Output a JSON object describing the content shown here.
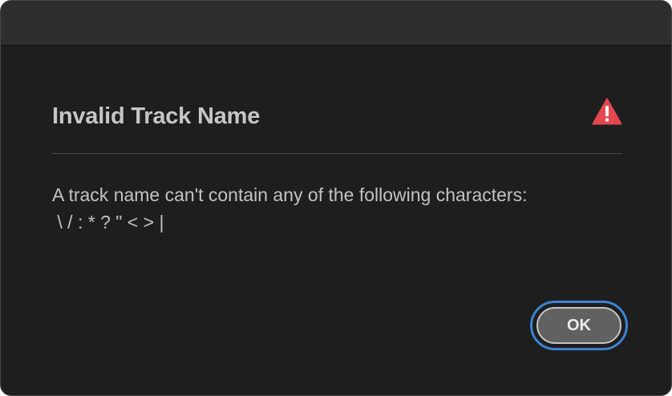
{
  "dialog": {
    "title": "Invalid Track Name",
    "icon": "warning-icon",
    "icon_color": "#e34850",
    "message_lines": [
      "A track name can't contain any of the following characters:",
      " \\ / : * ? \" < > |"
    ],
    "ok_label": "OK"
  },
  "colors": {
    "background": "#1e1e1e",
    "titlebar": "#2e2e2e",
    "focus_ring": "#3b83d4"
  }
}
